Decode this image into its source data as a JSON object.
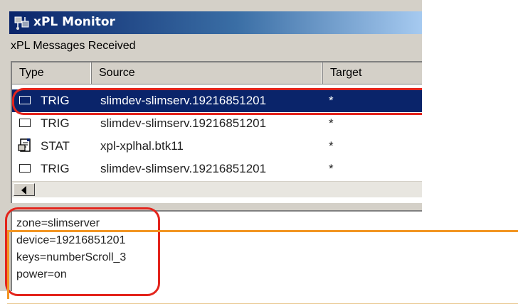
{
  "window": {
    "title": "xPL Monitor",
    "section_label": "xPL Messages Received"
  },
  "columns": [
    "Type",
    "Source",
    "Target"
  ],
  "messages": [
    {
      "type": "TRIG",
      "source": "slimdev-slimserv.19216851201",
      "target": "*",
      "icon": "envelope-icon",
      "selected": true
    },
    {
      "type": "TRIG",
      "source": "slimdev-slimserv.19216851201",
      "target": "*",
      "icon": "envelope-icon",
      "selected": false
    },
    {
      "type": "STAT",
      "source": "xpl-xplhal.btk11",
      "target": "*",
      "icon": "status-report-icon",
      "selected": false
    },
    {
      "type": "TRIG",
      "source": "slimdev-slimserv.19216851201",
      "target": "*",
      "icon": "envelope-icon",
      "selected": false
    }
  ],
  "details": [
    "zone=slimserver",
    "device=19216851201",
    "keys=numberScroll_3",
    "power=on"
  ],
  "colors": {
    "selection": "#0a246a",
    "highlight_outline": "#e3241c",
    "callout_line": "#f29522"
  }
}
